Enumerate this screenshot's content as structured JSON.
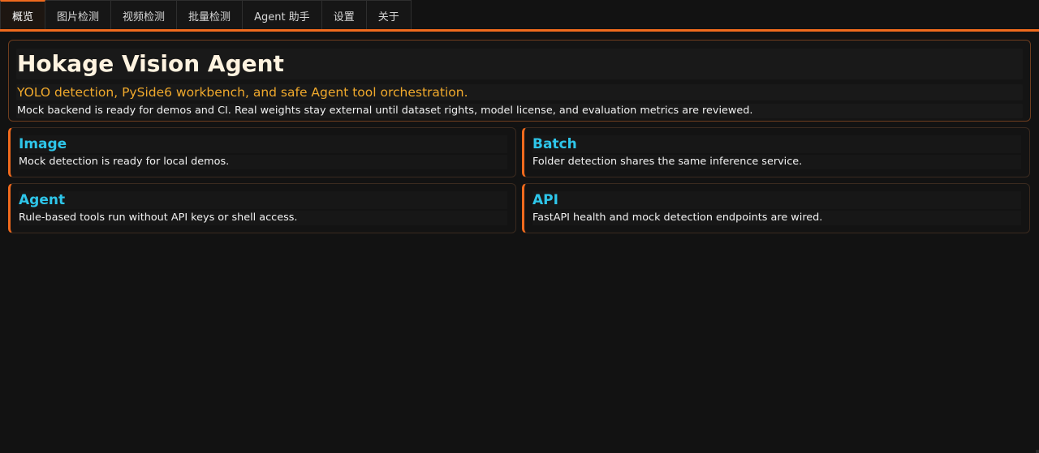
{
  "tabs": [
    {
      "label": "概览",
      "active": true
    },
    {
      "label": "图片检测",
      "active": false
    },
    {
      "label": "视频检测",
      "active": false
    },
    {
      "label": "批量检测",
      "active": false
    },
    {
      "label": "Agent 助手",
      "active": false
    },
    {
      "label": "设置",
      "active": false
    },
    {
      "label": "关于",
      "active": false
    }
  ],
  "hero": {
    "title": "Hokage Vision Agent",
    "subtitle": "YOLO detection, PySide6 workbench, and safe Agent tool orchestration.",
    "description": "Mock backend is ready for demos and CI. Real weights stay external until dataset rights, model license, and evaluation metrics are reviewed."
  },
  "cards": [
    {
      "title": "Image",
      "description": "Mock detection is ready for local demos."
    },
    {
      "title": "Batch",
      "description": "Folder detection shares the same inference service."
    },
    {
      "title": "Agent",
      "description": "Rule-based tools run without API keys or shell access."
    },
    {
      "title": "API",
      "description": "FastAPI health and mock detection endpoints are wired."
    }
  ],
  "colors": {
    "accent": "#f06a1d",
    "subtitle": "#f0a92c",
    "card_title": "#2ec6ea",
    "background": "#121212"
  }
}
